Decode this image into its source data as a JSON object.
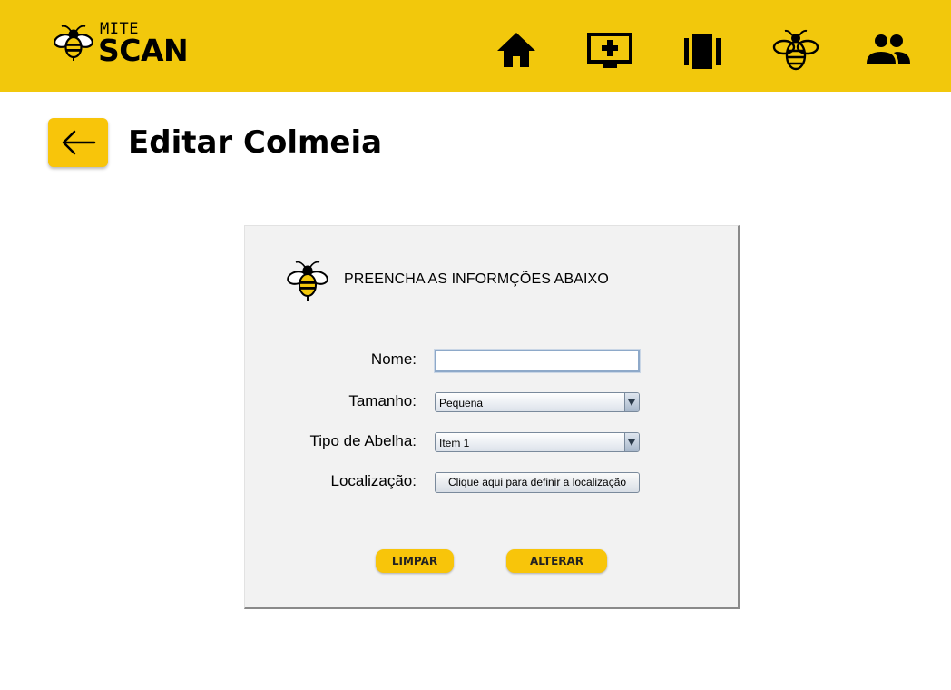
{
  "header": {
    "logo": {
      "brand_top": "MITE",
      "brand_bottom": "SCAN",
      "icon": "bee-icon"
    },
    "nav": [
      {
        "name": "home",
        "icon": "home-icon"
      },
      {
        "name": "add-monitor",
        "icon": "add-monitor-icon"
      },
      {
        "name": "hive-frames",
        "icon": "hive-frames-icon"
      },
      {
        "name": "bee",
        "icon": "bee-icon"
      },
      {
        "name": "users",
        "icon": "users-icon"
      }
    ],
    "background_color": "#f2c80c"
  },
  "page": {
    "back_icon": "arrow-left-icon",
    "title": "Editar Colmeia"
  },
  "form": {
    "heading": "PREENCHA AS INFORMÇÕES ABAIXO",
    "heading_icon": "bee-icon",
    "nome": {
      "label": "Nome:",
      "value": ""
    },
    "tamanho": {
      "label": "Tamanho:",
      "selected": "Pequena"
    },
    "tipo_abelha": {
      "label": "Tipo de Abelha:",
      "selected": "Item 1"
    },
    "localizacao": {
      "label": "Localização:",
      "button_label": "Clique aqui para definir a localização"
    },
    "limpar_label": "LIMPAR",
    "alterar_label": "ALTERAR",
    "accent_color": "#f8c50a"
  }
}
